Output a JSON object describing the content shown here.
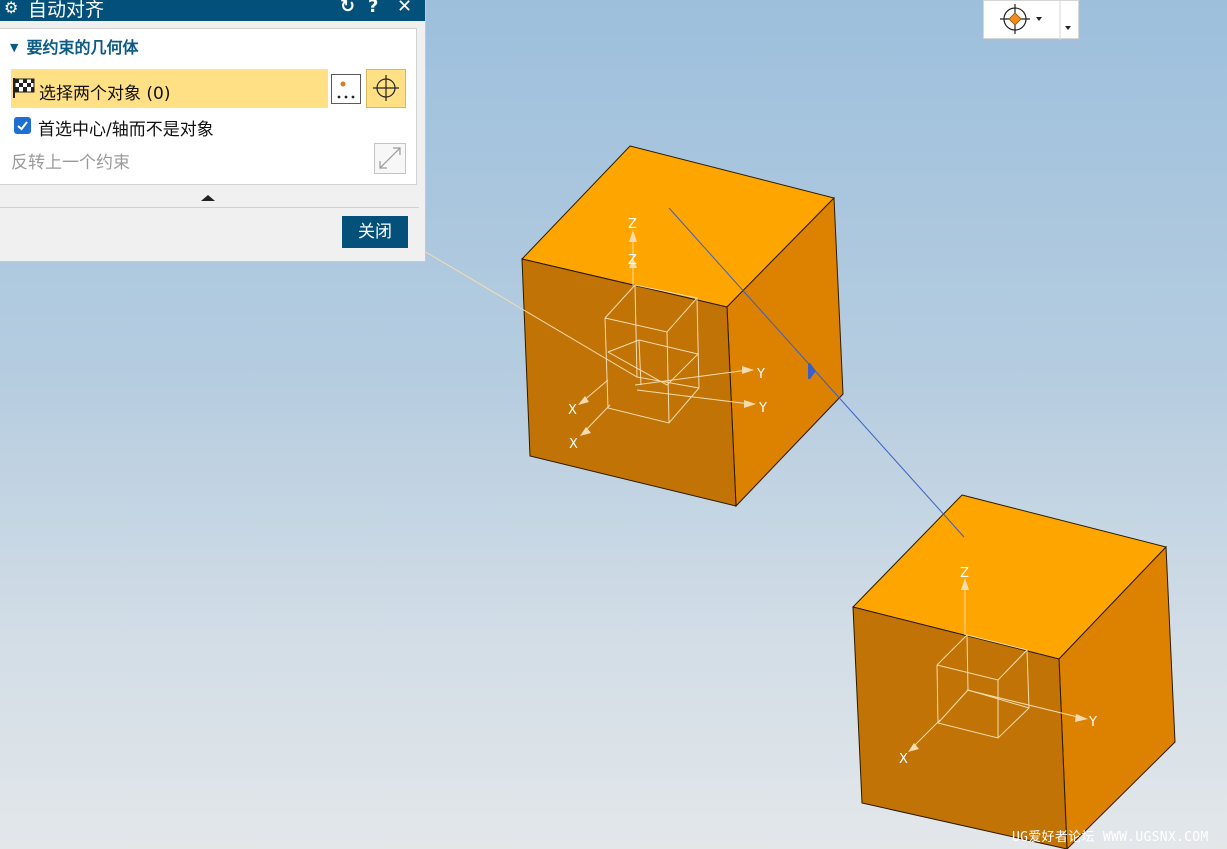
{
  "dialog": {
    "title": "自动对齐",
    "section_title": "要约束的几何体",
    "select_label": "选择两个对象 (0)",
    "checkbox_label": "首选中心/轴而不是对象",
    "checkbox_checked": true,
    "reverse_label": "反转上一个约束",
    "close_label": "关闭"
  },
  "colors": {
    "titlebar": "#03507a",
    "selection_highlight": "#ffe085",
    "cube_top": "#ffa500",
    "cube_right": "#dd8100",
    "cube_front": "#c17305"
  },
  "axis_labels": {
    "x": "X",
    "y": "Y",
    "z": "Z"
  },
  "watermark": "UG爱好者论坛 WWW.UGSNX.COM"
}
